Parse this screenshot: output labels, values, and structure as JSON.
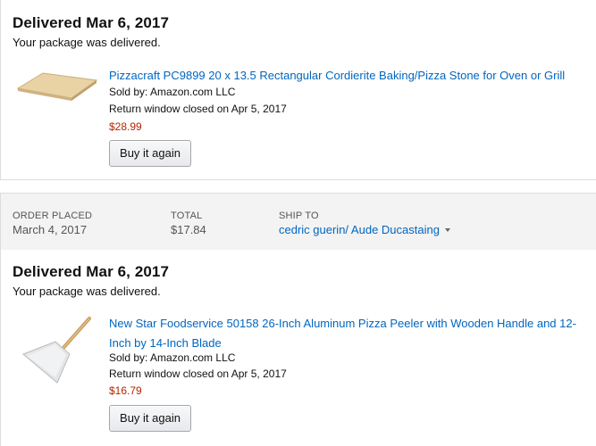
{
  "shipments": [
    {
      "status_title": "Delivered Mar 6, 2017",
      "status_sub": "Your package was delivered.",
      "item": {
        "title": "Pizzacraft PC9899 20 x 13.5 Rectangular Cordierite Baking/Pizza Stone for Oven or Grill",
        "seller": "Sold by: Amazon.com LLC",
        "return_window": "Return window closed on Apr 5, 2017",
        "price": "$28.99",
        "buy_again_label": "Buy it again",
        "image_icon": "pizza-stone-image"
      }
    },
    {
      "status_title": "Delivered Mar 6, 2017",
      "status_sub": "Your package was delivered.",
      "item": {
        "title": "New Star Foodservice 50158 26-Inch Aluminum Pizza Peeler with Wooden Handle and 12-Inch by 14-Inch Blade",
        "seller": "Sold by: Amazon.com LLC",
        "return_window": "Return window closed on Apr 5, 2017",
        "price": "$16.79",
        "buy_again_label": "Buy it again",
        "image_icon": "pizza-peel-image"
      }
    }
  ],
  "order_header": {
    "order_placed_label": "ORDER PLACED",
    "order_placed_value": "March 4, 2017",
    "total_label": "TOTAL",
    "total_value": "$17.84",
    "ship_to_label": "SHIP TO",
    "ship_to_value": "cedric guerin/ Aude Ducastaing"
  },
  "colors": {
    "link": "#0066c0",
    "price": "#b12704",
    "header_bg": "#f3f3f3",
    "border": "#dddddd"
  }
}
